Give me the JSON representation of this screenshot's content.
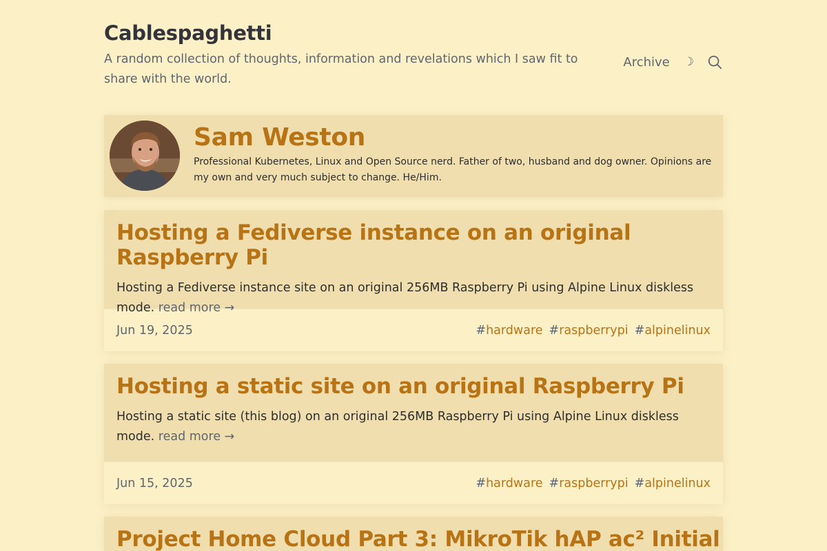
{
  "site": {
    "title": "Cablespaghetti",
    "tagline": "A random collection of thoughts, information and revelations which I saw fit to share with the world."
  },
  "nav": {
    "archive_label": "Archive",
    "theme_toggle_glyph": "☽",
    "search_icon": "search-icon"
  },
  "profile": {
    "name": "Sam Weston",
    "bio": "Professional Kubernetes, Linux and Open Source nerd. Father of two, husband and dog owner. Opinions are my own and very much subject to change. He/Him."
  },
  "posts": [
    {
      "title": "Hosting a Fediverse instance on an original Raspberry Pi",
      "summary": "Hosting a Fediverse instance site on an original 256MB Raspberry Pi using Alpine Linux diskless mode.",
      "read_more": "read more →",
      "date": "Jun 19, 2025",
      "tags": [
        "hardware",
        "raspberrypi",
        "alpinelinux"
      ]
    },
    {
      "title": "Hosting a static site on an original Raspberry Pi",
      "summary": "Hosting a static site (this blog) on an original 256MB Raspberry Pi using Alpine Linux diskless mode.",
      "read_more": "read more →",
      "date": "Jun 15, 2025",
      "tags": [
        "hardware",
        "raspberrypi",
        "alpinelinux"
      ]
    },
    {
      "title": "Project Home Cloud Part 3: MikroTik hAP ac² Initial"
    }
  ],
  "tag_prefix": "#",
  "colors": {
    "background": "#fcf0c7",
    "card": "#f0deaf",
    "accent": "#b87315",
    "muted": "#5f6670"
  }
}
